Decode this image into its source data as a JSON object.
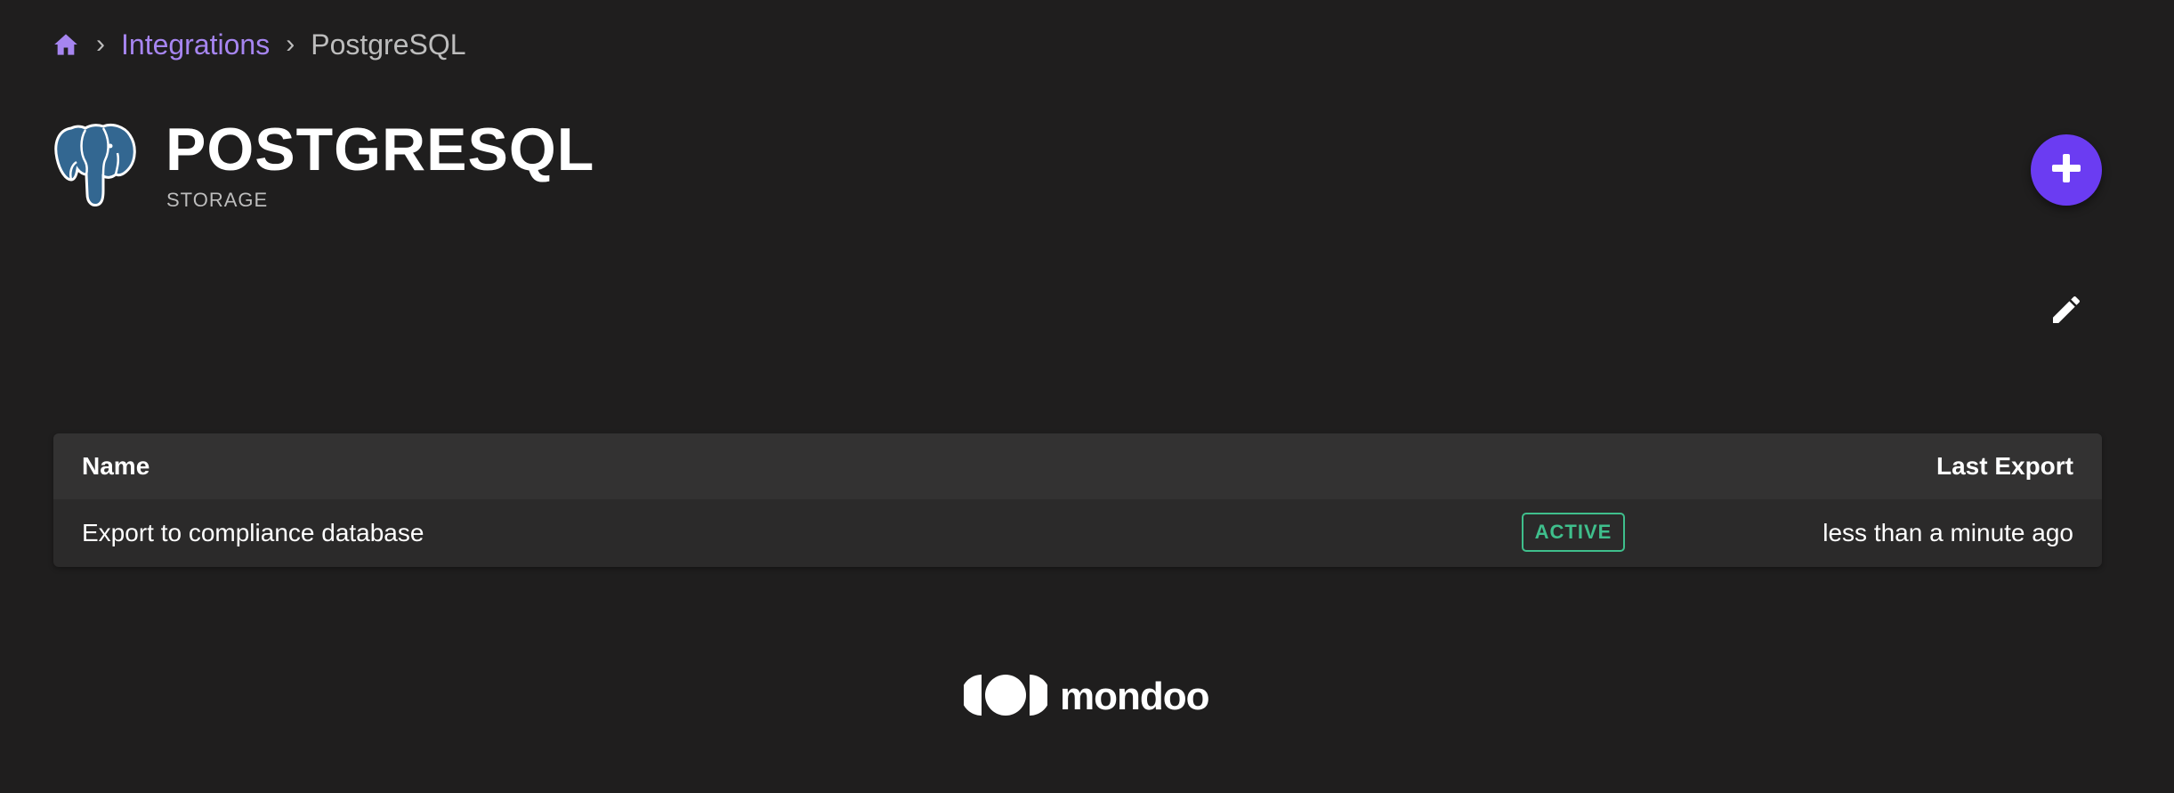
{
  "breadcrumb": {
    "home_icon": "home-icon",
    "separator": "›",
    "items": [
      "Integrations",
      "PostgreSQL"
    ]
  },
  "header": {
    "logo_icon": "postgresql-elephant-icon",
    "title": "POSTGRESQL",
    "subtitle": "STORAGE"
  },
  "actions": {
    "add_icon": "plus-icon",
    "edit_icon": "pencil-icon"
  },
  "table": {
    "columns": [
      "Name",
      "Last Export"
    ],
    "rows": [
      {
        "name": "Export to compliance database",
        "status": "ACTIVE",
        "last_export": "less than a minute ago"
      }
    ]
  },
  "footer": {
    "brand": "mondoo",
    "brand_icon": "mondoo-logo-icon"
  },
  "colors": {
    "background": "#1f1e1e",
    "accent": "#6b3cf2",
    "link": "#a685f0",
    "active_badge": "#3fbf8c"
  }
}
